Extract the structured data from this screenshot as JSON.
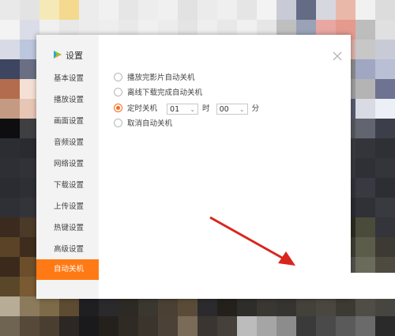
{
  "background": {
    "tile_colors": [
      "#e9e9e9",
      "#e3e3e3",
      "#f6e9b8",
      "#f4d98f",
      "#ececec",
      "#f1f1f1",
      "#e6e6e6",
      "#ededed",
      "#f0f0f0",
      "#e2e2e2",
      "#ebebeb",
      "#efefef",
      "#e5e5e5",
      "#f3f3f3",
      "#c8cbd6",
      "#636b85",
      "#d7d7e0",
      "#e9b8a9",
      "#f1f1f1",
      "#dcdcdc",
      "#f3f3f3",
      "#dadde8",
      "#f0f0f0",
      "#e8e8e8",
      "#ececec",
      "#eeeeee",
      "#e9e9e9",
      "#f0f0f0",
      "#ececec",
      "#e4e4e4",
      "#eeeeee",
      "#e8e8e8",
      "#f0f0f0",
      "#e6e6e6",
      "#bfbfbf",
      "#9aa2b8",
      "#e8a7a2",
      "#e59a8d",
      "#bdbdbd",
      "#e0e0e0",
      "#d8dbe6",
      "#bcc6dc",
      "#efefef",
      "#e5e5e5",
      "#ececec",
      "#eeeeee",
      "#e9e9e9",
      "#f0f0f0",
      "#ececec",
      "#e4e4e4",
      "#eeeeee",
      "#e8e8e8",
      "#f0f0f0",
      "#e6e6e6",
      "#b3b3b3",
      "#c3c3c3",
      "#b7b7b7",
      "#d8b0a8",
      "#c7c7c7",
      "#c8cbd6",
      "#3d4561",
      "#6a6f84",
      "#efefef",
      "#e5e5e5",
      "#ececec",
      "#eeeeee",
      "#e9e9e9",
      "#f0f0f0",
      "#ececec",
      "#e4e4e4",
      "#eeeeee",
      "#e8e8e8",
      "#f0f0f0",
      "#e6e6e6",
      "#9a9a9a",
      "#7d7d7d",
      "#a4a4a4",
      "#8b8b8b",
      "#9fa7c2",
      "#b9bfd4",
      "#b36c4d",
      "#f5e0d6",
      "#efefef",
      "#e5e5e5",
      "#ececec",
      "#eeeeee",
      "#e9e9e9",
      "#f0f0f0",
      "#ececec",
      "#e4e4e4",
      "#eeeeee",
      "#e8e8e8",
      "#f0f0f0",
      "#e6e6e6",
      "#8a8fa0",
      "#a9a9a9",
      "#8e8e8e",
      "#9d9d9d",
      "#b4b4b4",
      "#6d7390",
      "#c49a83",
      "#e8c6b5",
      "#efefef",
      "#e5e5e5",
      "#ececec",
      "#eeeeee",
      "#e9e9e9",
      "#f0f0f0",
      "#ececec",
      "#e4e4e4",
      "#eeeeee",
      "#e8e8e8",
      "#f0f0f0",
      "#e6e6e6",
      "#4b4f5d",
      "#5c5f6b",
      "#727272",
      "#575c70",
      "#d8dbe3",
      "#edeff6",
      "#0e0e10",
      "#3f3f41",
      "#efefef",
      "#e5e5e5",
      "#ececec",
      "#eeeeee",
      "#e9e9e9",
      "#f0f0f0",
      "#ececec",
      "#e4e4e4",
      "#eeeeee",
      "#e8e8e8",
      "#f0f0f0",
      "#e6e6e6",
      "#3c3e47",
      "#3f4146",
      "#47494f",
      "#55575e",
      "#626470",
      "#3c3f4a",
      "#2c2d33",
      "#2a2b31",
      "#efefef",
      "#e5e5e5",
      "#ececec",
      "#eeeeee",
      "#e9e9e9",
      "#f0f0f0",
      "#ececec",
      "#e4e4e4",
      "#eeeeee",
      "#e8e8e8",
      "#f0f0f0",
      "#e6e6e6",
      "#35363c",
      "#313238",
      "#2e2f35",
      "#393a40",
      "#34353b",
      "#2f3036",
      "#2e2f35",
      "#313238",
      "#efefef",
      "#e5e5e5",
      "#ececec",
      "#eeeeee",
      "#e9e9e9",
      "#f0f0f0",
      "#ececec",
      "#e4e4e4",
      "#eeeeee",
      "#e8e8e8",
      "#f0f0f0",
      "#e6e6e6",
      "#3a3b41",
      "#2c2d33",
      "#323339",
      "#37383e",
      "#2f3036",
      "#34353b",
      "#2b2c32",
      "#2e2f35",
      "#efefef",
      "#e5e5e5",
      "#ececec",
      "#eeeeee",
      "#e9e9e9",
      "#f0f0f0",
      "#ececec",
      "#e4e4e4",
      "#eeeeee",
      "#e8e8e8",
      "#f0f0f0",
      "#e6e6e6",
      "#303137",
      "#35363c",
      "#2b2c32",
      "#313238",
      "#383941",
      "#2d2e34",
      "#2f3036",
      "#33343a",
      "#efefef",
      "#e5e5e5",
      "#ececec",
      "#eeeeee",
      "#e9e9e9",
      "#f0f0f0",
      "#ececec",
      "#e4e4e4",
      "#eeeeee",
      "#e8e8e8",
      "#f0f0f0",
      "#e6e6e6",
      "#36373d",
      "#2e2f35",
      "#34353b",
      "#2a2b31",
      "#303137",
      "#393a40",
      "#3a2b1e",
      "#4b3a28",
      "#efefef",
      "#e5e5e5",
      "#ececec",
      "#eeeeee",
      "#e9e9e9",
      "#f0f0f0",
      "#ececec",
      "#e4e4e4",
      "#eeeeee",
      "#e8e8e8",
      "#f0f0f0",
      "#e6e6e6",
      "#2d2e34",
      "#33343a",
      "#3b3c2a",
      "#2b2c22",
      "#4a4b3a",
      "#34353b",
      "#5a4327",
      "#3e2d1c",
      "#efefef",
      "#e5e5e5",
      "#ececec",
      "#eeeeee",
      "#e9e9e9",
      "#f0f0f0",
      "#ececec",
      "#e4e4e4",
      "#eeeeee",
      "#e8e8e8",
      "#f0f0f0",
      "#e6e6e6",
      "#303137",
      "#36373d",
      "#2e2f25",
      "#3c3d33",
      "#5b5c4a",
      "#3d3a33",
      "#3b2a1b",
      "#6d4e2b",
      "#efefef",
      "#e5e5e5",
      "#ececec",
      "#eeeeee",
      "#e9e9e9",
      "#f0f0f0",
      "#ececec",
      "#e4e4e4",
      "#eeeeee",
      "#e8e8e8",
      "#f0f0f0",
      "#e6e6e6",
      "#38393f",
      "#2c2d33",
      "#3a3b31",
      "#51524a",
      "#6a6b5a",
      "#4f4a3f",
      "#5a4628",
      "#7a5a32",
      "#efefef",
      "#e5e5e5",
      "#ececec",
      "#eeeeee",
      "#e9e9e9",
      "#f0f0f0",
      "#ececec",
      "#e4e4e4",
      "#eeeeee",
      "#e8e8e8",
      "#f0f0f0",
      "#e6e6e6",
      "#2f3036",
      "#35363c",
      "#403f3a",
      "#4a4942",
      "#575650",
      "#45433d",
      "#b7ac95",
      "#8b7a5c",
      "#7d6a48",
      "#5d4b32",
      "#1f1f22",
      "#2a2a2d",
      "#2d2a25",
      "#3a3630",
      "#4a4033",
      "#5a4b38",
      "#2b2b2e",
      "#24201b",
      "#2e2d2a",
      "#3a3733",
      "#353430",
      "#44413b",
      "#4a4740",
      "#3d3a34",
      "#504d46",
      "#474540",
      "#6f6352",
      "#56493a",
      "#4a3e30",
      "#2c2722",
      "#1a1a1c",
      "#24211d",
      "#2f2a24",
      "#3b342c",
      "#4c4136",
      "#7a6a58",
      "#3a3530",
      "#45403a",
      "#bcbcbc",
      "#a5a5a5",
      "#8c8c8c",
      "#3a3a3a",
      "#4a4a4a",
      "#5a5a5a",
      "#6a6a6a",
      "#2a2a2a"
    ]
  },
  "dialog": {
    "title": "设置",
    "close_icon": "close-icon",
    "logo_icon": "play-logo-icon",
    "accent_color": "#ff7a14"
  },
  "sidebar": {
    "items": [
      {
        "label": "基本设置",
        "active": false
      },
      {
        "label": "播放设置",
        "active": false
      },
      {
        "label": "画面设置",
        "active": false
      },
      {
        "label": "音频设置",
        "active": false
      },
      {
        "label": "网络设置",
        "active": false
      },
      {
        "label": "下载设置",
        "active": false
      },
      {
        "label": "上传设置",
        "active": false
      },
      {
        "label": "热键设置",
        "active": false
      },
      {
        "label": "高级设置",
        "active": false
      },
      {
        "label": "自动关机",
        "active": true
      }
    ]
  },
  "options": {
    "items": [
      {
        "label": "播放完影片自动关机",
        "checked": false
      },
      {
        "label": "离线下载完成自动关机",
        "checked": false
      },
      {
        "label": "定时关机",
        "checked": true
      },
      {
        "label": "取消自动关机",
        "checked": false
      }
    ],
    "timer": {
      "hour_value": "01",
      "hour_unit": "时",
      "minute_value": "00",
      "minute_unit": "分"
    }
  }
}
